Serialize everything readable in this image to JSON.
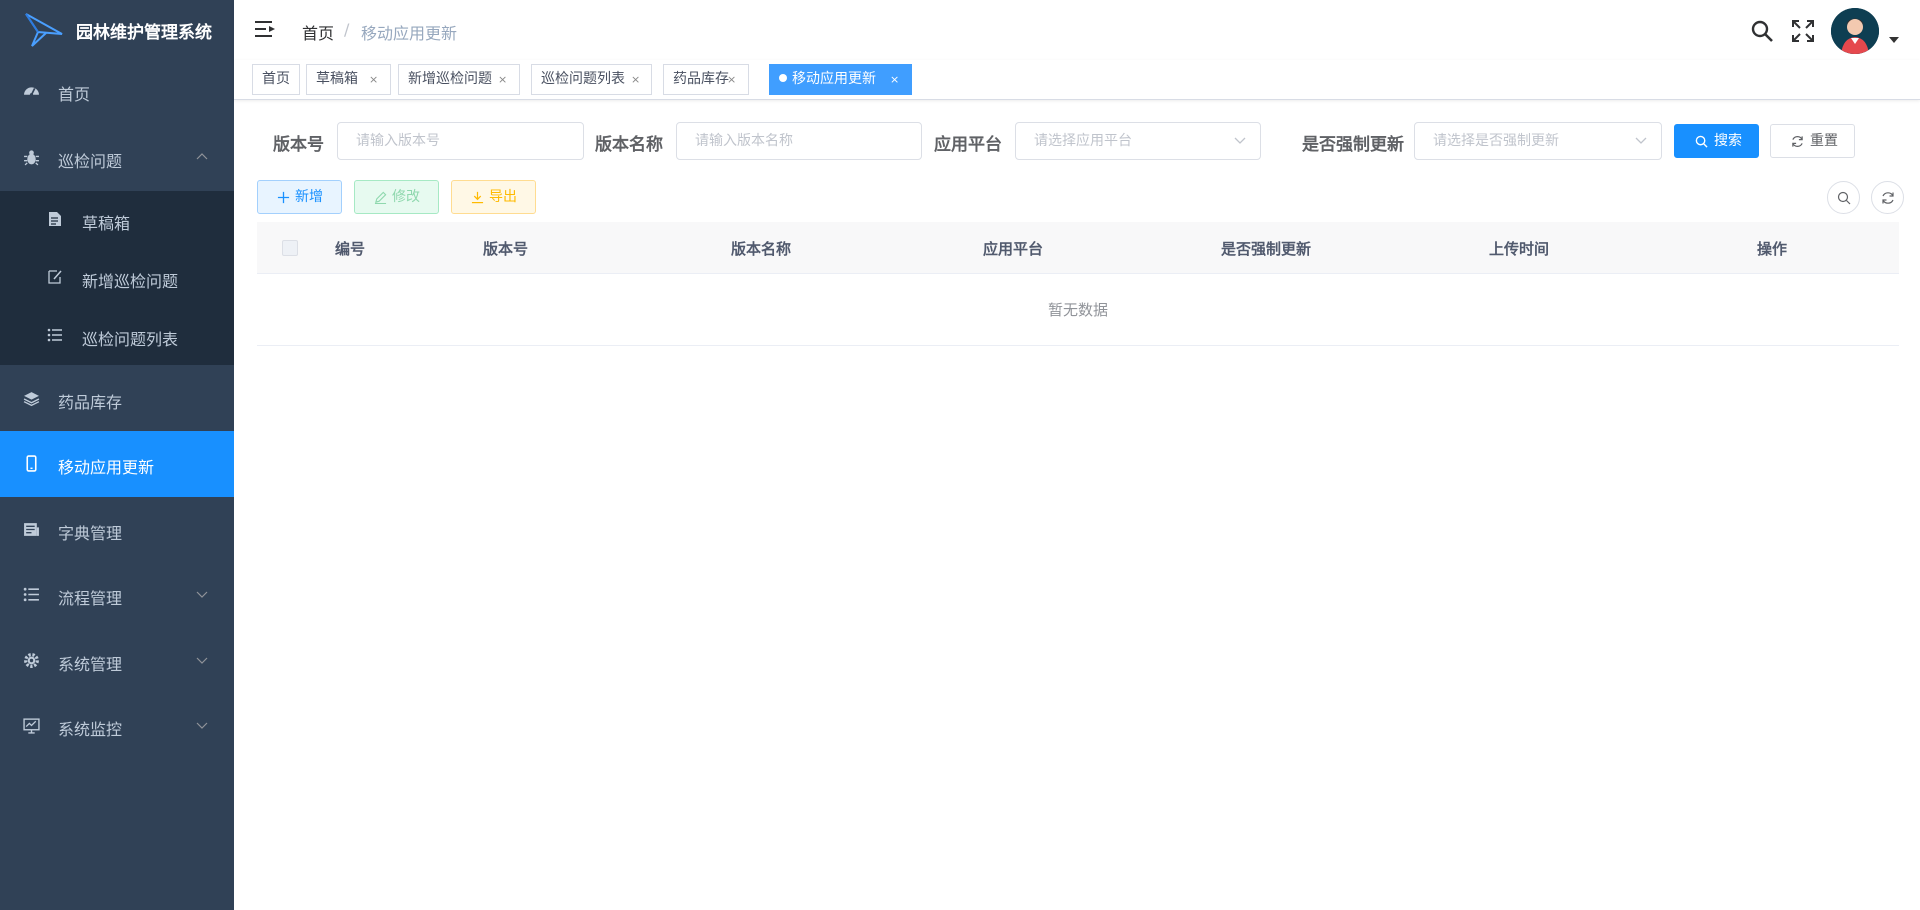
{
  "app": {
    "title": "园林维护管理系统"
  },
  "sidebar": {
    "items": [
      {
        "label": "首页",
        "icon": "dashboard-icon"
      },
      {
        "label": "巡检问题",
        "icon": "bug-icon",
        "expanded": true
      },
      {
        "label": "药品库存",
        "icon": "layers-icon"
      },
      {
        "label": "移动应用更新",
        "icon": "phone-icon",
        "active": true
      },
      {
        "label": "字典管理",
        "icon": "dictionary-icon"
      },
      {
        "label": "流程管理",
        "icon": "list-icon"
      },
      {
        "label": "系统管理",
        "icon": "gear-icon"
      },
      {
        "label": "系统监控",
        "icon": "monitor-icon"
      }
    ],
    "submenu": [
      {
        "label": "草稿箱",
        "icon": "document-icon"
      },
      {
        "label": "新增巡检问题",
        "icon": "edit-icon"
      },
      {
        "label": "巡检问题列表",
        "icon": "list-icon"
      }
    ]
  },
  "navbar": {
    "breadcrumb": [
      "首页",
      "移动应用更新"
    ],
    "breadcrumb_separator": "/"
  },
  "tags": [
    {
      "label": "首页",
      "closable": false
    },
    {
      "label": "草稿箱",
      "closable": true
    },
    {
      "label": "新增巡检问题",
      "closable": true
    },
    {
      "label": "巡检问题列表",
      "closable": true
    },
    {
      "label": "药品库存",
      "closable": true
    },
    {
      "label": "移动应用更新",
      "closable": true,
      "active": true
    }
  ],
  "tag_close_glyph": "×",
  "search_form": {
    "version_no": {
      "label": "版本号",
      "placeholder": "请输入版本号"
    },
    "version_name": {
      "label": "版本名称",
      "placeholder": "请输入版本名称"
    },
    "platform": {
      "label": "应用平台",
      "placeholder": "请选择应用平台"
    },
    "force_update": {
      "label": "是否强制更新",
      "placeholder": "请选择是否强制更新"
    },
    "search_label": "搜索",
    "reset_label": "重置"
  },
  "toolbar": {
    "add_label": "新增",
    "edit_label": "修改",
    "export_label": "导出"
  },
  "table": {
    "columns": [
      "编号",
      "版本号",
      "版本名称",
      "应用平台",
      "是否强制更新",
      "上传时间",
      "操作"
    ],
    "rows": [],
    "empty_text": "暂无数据"
  },
  "colors": {
    "sidebar_bg": "#304156",
    "submenu_bg": "#1f2d3d",
    "primary": "#1890ff",
    "active_tag": "#409eff",
    "success": "#13ce66",
    "warning": "#ffba00"
  }
}
